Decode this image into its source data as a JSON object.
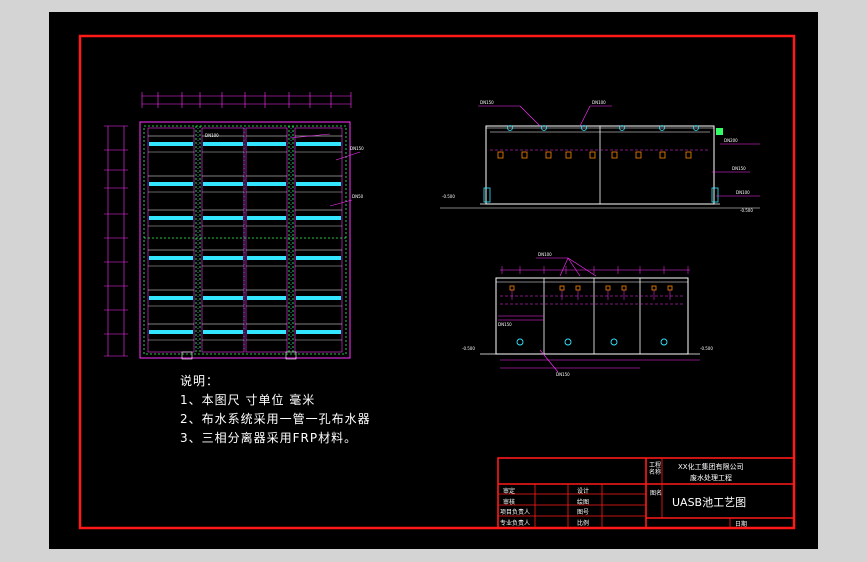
{
  "notes": {
    "heading": "说明：",
    "items": [
      "1、本图尺 寸单位 毫米",
      "2、布水系统采用一管一孔布水器",
      "3、三相分离器采用FRP材料。"
    ]
  },
  "title_block": {
    "project_label": "工程名称",
    "project_line1": "XX化工集团有限公司",
    "project_line2": "废水处理工程",
    "drawing_label": "图名",
    "drawing_title": "UASB池工艺图",
    "rows": [
      {
        "left": "审定",
        "right": "设计"
      },
      {
        "left": "审核",
        "right": "绘图"
      },
      {
        "left": "项目负责人",
        "right": "图号"
      },
      {
        "left": "专业负责人",
        "right": "比例"
      }
    ],
    "date_label": "日期"
  },
  "colors": {
    "frame": "#ff1a1a",
    "drawing": "#ff33ff",
    "pipe": "#33e6ff",
    "dim": "#ffffff",
    "background": "#000000"
  }
}
